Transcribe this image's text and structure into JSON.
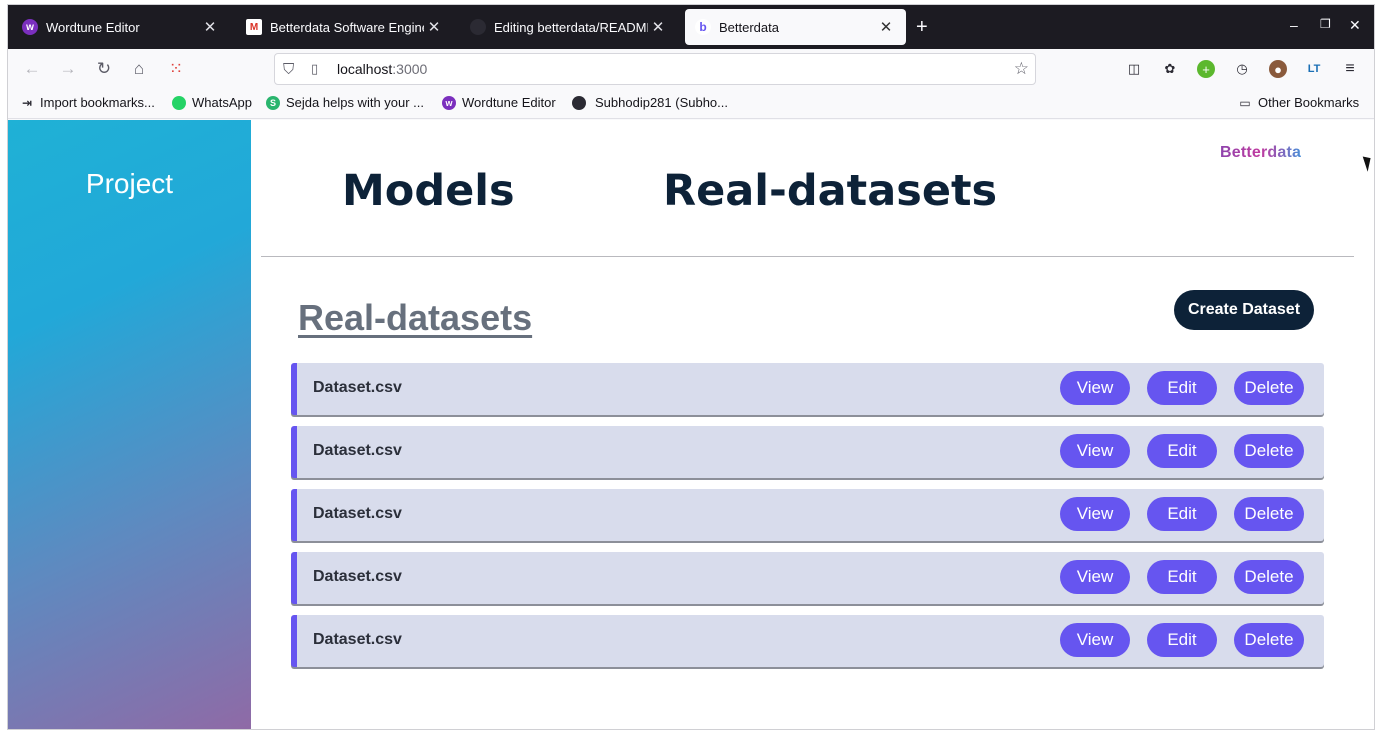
{
  "browser": {
    "tabs": [
      {
        "title": "Wordtune Editor",
        "icon": "wordtune-icon",
        "active": false
      },
      {
        "title": "Betterdata Software Engineer",
        "icon": "gmail-icon",
        "active": false
      },
      {
        "title": "Editing betterdata/README",
        "icon": "github-icon",
        "active": false
      },
      {
        "title": "Betterdata",
        "icon": "betterdata-icon",
        "active": true
      }
    ],
    "new_tab": "+",
    "url": {
      "host": "localhost",
      "port": ":3000"
    },
    "bookmarks": [
      {
        "label": "Import bookmarks...",
        "icon": "import-icon"
      },
      {
        "label": "WhatsApp",
        "icon": "whatsapp-icon"
      },
      {
        "label": "Sejda helps with your ...",
        "icon": "sejda-icon"
      },
      {
        "label": "Wordtune Editor",
        "icon": "wordtune-icon"
      },
      {
        "label": "Subhodip281 (Subho...",
        "icon": "github-icon"
      }
    ],
    "other_bookmarks": "Other Bookmarks"
  },
  "page": {
    "sidebar_title": "Project",
    "brand": "Betterdata",
    "nav": {
      "models": "Models",
      "real_datasets": "Real-datasets"
    },
    "section_title": "Real-datasets",
    "create_button": "Create Dataset",
    "datasets": [
      {
        "name": "Dataset.csv",
        "view": "View",
        "edit": "Edit",
        "delete": "Delete"
      },
      {
        "name": "Dataset.csv",
        "view": "View",
        "edit": "Edit",
        "delete": "Delete"
      },
      {
        "name": "Dataset.csv",
        "view": "View",
        "edit": "Edit",
        "delete": "Delete"
      },
      {
        "name": "Dataset.csv",
        "view": "View",
        "edit": "Edit",
        "delete": "Delete"
      },
      {
        "name": "Dataset.csv",
        "view": "View",
        "edit": "Edit",
        "delete": "Delete"
      }
    ]
  },
  "colors": {
    "accent": "#6655f0",
    "dark_navy": "#0d2238",
    "row_bg": "#d8dcec"
  }
}
